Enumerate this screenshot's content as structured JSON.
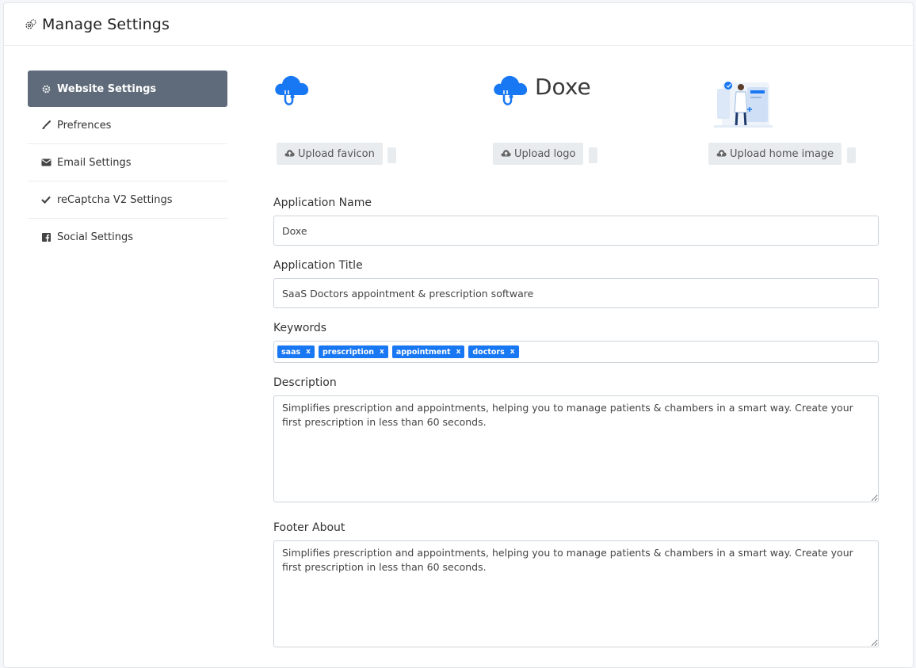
{
  "header": {
    "title": "Manage Settings",
    "icon": "gears-icon"
  },
  "sidebar": {
    "items": [
      {
        "label": "Website Settings",
        "icon": "gear-icon",
        "active": true
      },
      {
        "label": "Prefrences",
        "icon": "brush-icon",
        "active": false
      },
      {
        "label": "Email Settings",
        "icon": "envelope-icon",
        "active": false
      },
      {
        "label": "reCaptcha V2 Settings",
        "icon": "check-icon",
        "active": false
      },
      {
        "label": "Social Settings",
        "icon": "facebook-icon",
        "active": false
      }
    ]
  },
  "uploads": {
    "favicon_label": "Upload favicon",
    "logo_label": "Upload logo",
    "logo_text": "Doxe",
    "home_image_label": "Upload home image"
  },
  "form": {
    "app_name": {
      "label": "Application Name",
      "value": "Doxe"
    },
    "app_title": {
      "label": "Application Title",
      "value": "SaaS Doctors appointment & prescription software"
    },
    "keywords": {
      "label": "Keywords",
      "tags": [
        "saas",
        "prescription",
        "appointment",
        "doctors"
      ],
      "remove_glyph": "x"
    },
    "description": {
      "label": "Description",
      "value": "Simplifies prescription and appointments, helping you to manage patients & chambers in a smart way. Create your first prescription in less than 60 seconds."
    },
    "footer_about": {
      "label": "Footer About",
      "value": "Simplifies prescription and appointments, helping you to manage patients & chambers in a smart way. Create your first prescription in less than 60 seconds."
    }
  },
  "colors": {
    "accent": "#1877f2",
    "sidebar_active": "#5f6b7a",
    "button_bg": "#e9ecef"
  }
}
